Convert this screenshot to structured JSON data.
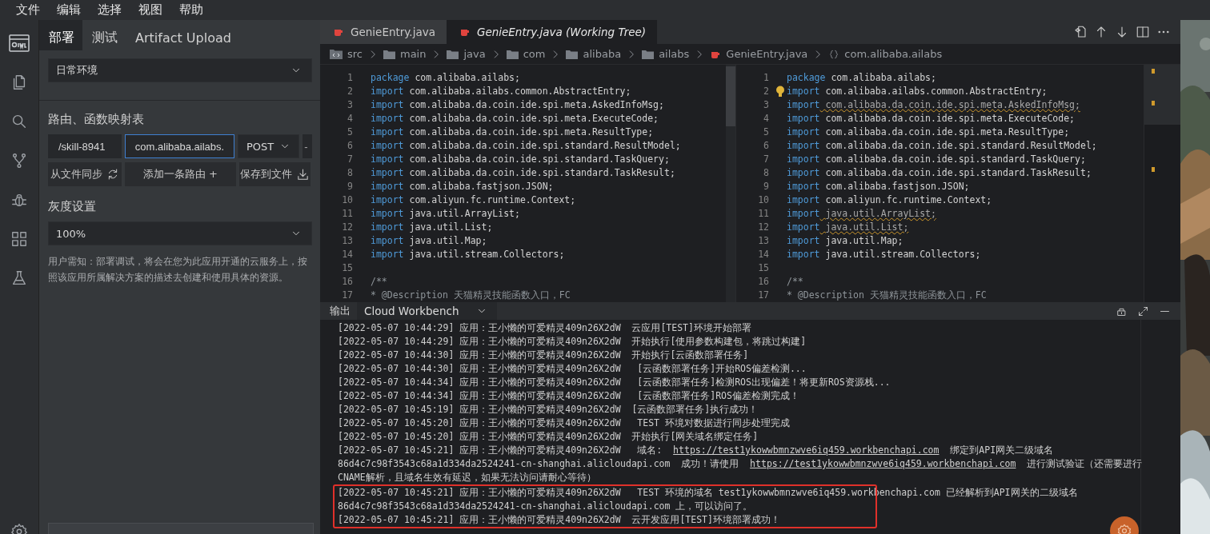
{
  "menu": [
    {
      "label": "文件"
    },
    {
      "label": "编辑"
    },
    {
      "label": "选择"
    },
    {
      "label": "视图"
    },
    {
      "label": "帮助"
    }
  ],
  "side_panel": {
    "tabs": [
      {
        "label": "部署",
        "selected": true
      },
      {
        "label": "测试",
        "selected": false
      },
      {
        "label": "Artifact Upload",
        "selected": false
      }
    ],
    "environment_select": {
      "value": "日常环境"
    },
    "route_section": {
      "title": "路由、函数映射表",
      "path_field": {
        "value": "/skill-8941"
      },
      "handler_field": {
        "value": "com.alibaba.ailabs.",
        "focused": true
      },
      "method_select": {
        "value": "POST"
      },
      "remove_button": "-",
      "buttons": [
        {
          "label": "从文件同步",
          "kind": "sync"
        },
        {
          "label": "添加一条路由 +",
          "kind": "add"
        },
        {
          "label": "保存到文件",
          "kind": "save"
        }
      ]
    },
    "gray_section": {
      "title": "灰度设置",
      "select": {
        "value": "100%"
      }
    },
    "notice": "用户需知：部署调试，将会在您为此应用开通的云服务上，按照该应用所属解决方案的描述去创建和使用具体的资源。"
  },
  "editor": {
    "tabs": [
      {
        "label": "GenieEntry.java",
        "selected": false,
        "preview": false
      },
      {
        "label": "GenieEntry.java (Working Tree)",
        "selected": true,
        "preview": true
      }
    ],
    "breadcrumb": [
      {
        "label": "src",
        "kind": "root"
      },
      {
        "label": "main",
        "kind": "folder"
      },
      {
        "label": "java",
        "kind": "folder"
      },
      {
        "label": "com",
        "kind": "folder"
      },
      {
        "label": "alibaba",
        "kind": "folder"
      },
      {
        "label": "ailabs",
        "kind": "folder"
      },
      {
        "label": "GenieEntry.java",
        "kind": "java"
      },
      {
        "label": "com.alibaba.ailabs",
        "kind": "namespace"
      }
    ],
    "panes": [
      {
        "lines": [
          {
            "number": "1",
            "kind": "code",
            "keyword": "package",
            "text": " com.alibaba.ailabs;"
          },
          {
            "number": "2",
            "kind": "code",
            "keyword": "import",
            "text": " com.alibaba.ailabs.common.AbstractEntry;"
          },
          {
            "number": "3",
            "kind": "code",
            "keyword": "import",
            "text": " com.alibaba.da.coin.ide.spi.meta.AskedInfoMsg;"
          },
          {
            "number": "4",
            "kind": "code",
            "keyword": "import",
            "text": " com.alibaba.da.coin.ide.spi.meta.ExecuteCode;"
          },
          {
            "number": "5",
            "kind": "code",
            "keyword": "import",
            "text": " com.alibaba.da.coin.ide.spi.meta.ResultType;"
          },
          {
            "number": "6",
            "kind": "code",
            "keyword": "import",
            "text": " com.alibaba.da.coin.ide.spi.standard.ResultModel;"
          },
          {
            "number": "7",
            "kind": "code",
            "keyword": "import",
            "text": " com.alibaba.da.coin.ide.spi.standard.TaskQuery;"
          },
          {
            "number": "8",
            "kind": "code",
            "keyword": "import",
            "text": " com.alibaba.da.coin.ide.spi.standard.TaskResult;"
          },
          {
            "number": "9",
            "kind": "code",
            "keyword": "import",
            "text": " com.alibaba.fastjson.JSON;"
          },
          {
            "number": "10",
            "kind": "code",
            "keyword": "import",
            "text": " com.aliyun.fc.runtime.Context;"
          },
          {
            "number": "11",
            "kind": "code",
            "keyword": "import",
            "text": " java.util.ArrayList;"
          },
          {
            "number": "12",
            "kind": "code",
            "keyword": "import",
            "text": " java.util.List;"
          },
          {
            "number": "13",
            "kind": "code",
            "keyword": "import",
            "text": " java.util.Map;"
          },
          {
            "number": "14",
            "kind": "code",
            "keyword": "import",
            "text": " java.util.stream.Collectors;"
          },
          {
            "number": "15",
            "kind": "blank"
          },
          {
            "number": "16",
            "kind": "comment",
            "text": "/**"
          },
          {
            "number": "17",
            "kind": "comment",
            "text": "* @Description 天猫精灵技能函数入口，FC"
          }
        ]
      },
      {
        "lines": [
          {
            "number": "1",
            "kind": "code",
            "keyword": "package",
            "text": " com.alibaba.ailabs;"
          },
          {
            "number": "2",
            "kind": "code",
            "keyword": "import",
            "text": " com.alibaba.ailabs.common.AbstractEntry;",
            "hint": true
          },
          {
            "number": "3",
            "kind": "code",
            "keyword": "import",
            "text": " com.alibaba.da.coin.ide.spi.meta.AskedInfoMsg;",
            "warning": true
          },
          {
            "number": "4",
            "kind": "code",
            "keyword": "import",
            "text": " com.alibaba.da.coin.ide.spi.meta.ExecuteCode;"
          },
          {
            "number": "5",
            "kind": "code",
            "keyword": "import",
            "text": " com.alibaba.da.coin.ide.spi.meta.ResultType;"
          },
          {
            "number": "6",
            "kind": "code",
            "keyword": "import",
            "text": " com.alibaba.da.coin.ide.spi.standard.ResultModel;"
          },
          {
            "number": "7",
            "kind": "code",
            "keyword": "import",
            "text": " com.alibaba.da.coin.ide.spi.standard.TaskQuery;"
          },
          {
            "number": "8",
            "kind": "code",
            "keyword": "import",
            "text": " com.alibaba.da.coin.ide.spi.standard.TaskResult;"
          },
          {
            "number": "9",
            "kind": "code",
            "keyword": "import",
            "text": " com.alibaba.fastjson.JSON;"
          },
          {
            "number": "10",
            "kind": "code",
            "keyword": "import",
            "text": " com.aliyun.fc.runtime.Context;"
          },
          {
            "number": "11",
            "kind": "code",
            "keyword": "import",
            "text": " java.util.ArrayList;",
            "warning": true
          },
          {
            "number": "12",
            "kind": "code",
            "keyword": "import",
            "text": " java.util.List;",
            "warning": true
          },
          {
            "number": "13",
            "kind": "code",
            "keyword": "import",
            "text": " java.util.Map;"
          },
          {
            "number": "14",
            "kind": "code",
            "keyword": "import",
            "text": " java.util.stream.Collectors;"
          },
          {
            "number": "15",
            "kind": "blank"
          },
          {
            "number": "16",
            "kind": "comment",
            "text": "/**"
          },
          {
            "number": "17",
            "kind": "comment",
            "text": "* @Description 天猫精灵技能函数入口，FC"
          }
        ]
      }
    ]
  },
  "output": {
    "tab": "输出",
    "channel_select": "Cloud Workbench",
    "entries": [
      {
        "highlighted": false,
        "lines": [
          [
            {
              "text": "[2022-05-07 10:44:29] 应用：王小懒的可爱精灵409n26X2dW  云应用[TEST]环境开始部署"
            }
          ]
        ]
      },
      {
        "highlighted": false,
        "lines": [
          [
            {
              "text": "[2022-05-07 10:44:29] 应用：王小懒的可爱精灵409n26X2dW  开始执行[使用参数构建包，将跳过构建]"
            }
          ]
        ]
      },
      {
        "highlighted": false,
        "lines": [
          [
            {
              "text": "[2022-05-07 10:44:30] 应用：王小懒的可爱精灵409n26X2dW  开始执行[云函数部署任务]"
            }
          ]
        ]
      },
      {
        "highlighted": false,
        "lines": [
          [
            {
              "text": "[2022-05-07 10:44:30] 应用：王小懒的可爱精灵409n26X2dW   [云函数部署任务]开始ROS偏差检测..."
            }
          ]
        ]
      },
      {
        "highlighted": false,
        "lines": [
          [
            {
              "text": "[2022-05-07 10:44:34] 应用：王小懒的可爱精灵409n26X2dW   [云函数部署任务]检测ROS出现偏差！将更新ROS资源栈..."
            }
          ]
        ]
      },
      {
        "highlighted": false,
        "lines": [
          [
            {
              "text": "[2022-05-07 10:44:34] 应用：王小懒的可爱精灵409n26X2dW   [云函数部署任务]ROS偏差检测完成！"
            }
          ]
        ]
      },
      {
        "highlighted": false,
        "lines": [
          [
            {
              "text": "[2022-05-07 10:45:19] 应用：王小懒的可爱精灵409n26X2dW  [云函数部署任务]执行成功！"
            }
          ]
        ]
      },
      {
        "highlighted": false,
        "lines": [
          [
            {
              "text": "[2022-05-07 10:45:20] 应用：王小懒的可爱精灵409n26X2dW   TEST 环境对数据进行同步处理完成"
            }
          ]
        ]
      },
      {
        "highlighted": false,
        "lines": [
          [
            {
              "text": "[2022-05-07 10:45:20] 应用：王小懒的可爱精灵409n26X2dW  开始执行[网关域名绑定任务]"
            }
          ]
        ]
      },
      {
        "highlighted": false,
        "lines": [
          [
            {
              "text": "[2022-05-07 10:45:21] 应用：王小懒的可爱精灵409n26X2dW   域名:  "
            },
            {
              "text": "https://test1ykowwbmnzwve6iq459.workbenchapi.com",
              "link": true
            },
            {
              "text": "  绑定到API网关二级域名"
            }
          ],
          [
            {
              "text": "86d4c7c98f3543c68a1d334da2524241-cn-shanghai.alicloudapi.com  成功！请使用  "
            },
            {
              "text": "https://test1ykowwbmnzwve6iq459.workbenchapi.com",
              "link": true
            },
            {
              "text": "  进行测试验证（还需要进行"
            }
          ],
          [
            {
              "text": "CNAME解析，且域名生效有延迟，如果无法访问请耐心等待）"
            }
          ]
        ]
      },
      {
        "highlighted": true,
        "lines": [
          [
            {
              "text": "[2022-05-07 10:45:21] 应用：王小懒的可爱精灵409n26X2dW   TEST 环境的域名 test1ykowwbmnzwve6iq459.workbenchapi.com 已经解析到API网关的二级域名"
            }
          ],
          [
            {
              "text": "86d4c7c98f3543c68a1d334da2524241-cn-shanghai.alicloudapi.com 上，可以访问了。"
            }
          ]
        ]
      },
      {
        "highlighted": true,
        "lines": [
          [
            {
              "text": "[2022-05-07 10:45:21] 应用：王小懒的可爱精灵409n26X2dW  云开发应用[TEST]环境部署成功！"
            }
          ]
        ]
      }
    ]
  }
}
